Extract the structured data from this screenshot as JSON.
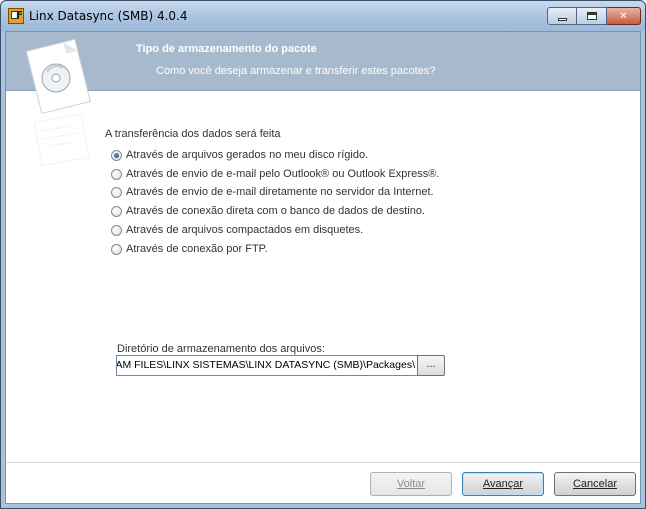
{
  "window": {
    "title": "Linx Datasync (SMB) 4.0.4"
  },
  "banner": {
    "title": "Tipo de armazenamento do pacote",
    "subtitle": "Como você deseja armazenar e transferir estes pacotes?"
  },
  "transfer": {
    "group_label": "A transferência dos dados será feita",
    "selected_index": 0,
    "options": [
      "Através de arquivos gerados no meu disco rígido.",
      "Através de envio de e-mail pelo Outlook® ou Outlook Express®.",
      "Através de envio de e-mail diretamente no servidor da Internet.",
      "Através de conexão direta com o banco de dados de destino.",
      "Através de arquivos compactados em disquetes.",
      "Através de conexão por FTP."
    ]
  },
  "directory": {
    "label": "Diretório de armazenamento dos arquivos:",
    "value": ":AM FILES\\LINX SISTEMAS\\LINX DATASYNC (SMB)\\Packages\\",
    "browse_label": "..."
  },
  "buttons": {
    "back": "Voltar",
    "next": "Avançar",
    "cancel": "Cancelar"
  },
  "colors": {
    "banner": "#a7b9cc",
    "titlebar": "#aac3df",
    "radio_selected": "#1d3f86"
  }
}
